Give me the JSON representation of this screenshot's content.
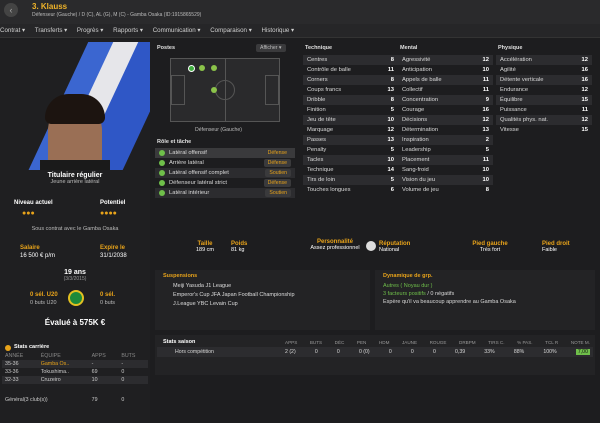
{
  "header": {
    "title": "3. Klauss",
    "subtitle": "Défenseur (Gauche) / D (C), AL (G), M (C) - Gamba Osaka (ID:1915865529)"
  },
  "menu": [
    "Contrat ▾",
    "Transferts ▾",
    "Progrès ▾",
    "Rapports ▾",
    "Communication ▾",
    "Comparaison ▾",
    "Historique ▾"
  ],
  "profile": {
    "role": "Titulaire régulier",
    "role_sub": "Jeune arrière latéral",
    "level_label": "Niveau actuel",
    "potential_label": "Potentiel",
    "contract": "Sous contrat avec le Gamba Osaka",
    "salary_label": "Salaire",
    "salary": "16 500 € p/m",
    "expiry_label": "Expire le",
    "expiry": "31/1/2038",
    "age": "19 ans",
    "dob": "(3/3/2015)",
    "u20_1": "0 sél. U20",
    "u20_1b": "0 buts U20",
    "u20_2": "0 sél.",
    "u20_2b": "0 buts",
    "value": "Évalué à 575K €"
  },
  "career": {
    "title": "Stats carrière",
    "headers": [
      "ANNÉE",
      "ÉQUIPE",
      "APPS",
      "BUTS"
    ],
    "rows": [
      [
        "35-36",
        "Gamba Os..",
        "-",
        "-"
      ],
      [
        "33-36",
        "Tokushima..",
        "69",
        "0"
      ],
      [
        "32-33",
        "Cruzeiro",
        "10",
        "0"
      ]
    ],
    "total": [
      "Général(3 club(s))",
      "79",
      "0"
    ]
  },
  "positions": {
    "title": "Postes",
    "btn": "Afficher ▾",
    "caption": "Défenseur (Gauche)"
  },
  "roles": {
    "title": "Rôle et tâche",
    "items": [
      [
        "Latéral offensif",
        "Défense"
      ],
      [
        "Arrière latéral",
        "Défense"
      ],
      [
        "Latéral offensif complet",
        "Soutien"
      ],
      [
        "Défenseur latéral strict",
        "Défense"
      ],
      [
        "Latéral intérieur",
        "Soutien"
      ]
    ]
  },
  "technique": {
    "title": "Technique",
    "rows": [
      [
        "Centres",
        "8"
      ],
      [
        "Contrôle de balle",
        "11"
      ],
      [
        "Corners",
        "8"
      ],
      [
        "Coups francs",
        "13"
      ],
      [
        "Dribble",
        "8"
      ],
      [
        "Finition",
        "5"
      ],
      [
        "Jeu de tête",
        "10"
      ],
      [
        "Marquage",
        "12"
      ],
      [
        "Passes",
        "13"
      ],
      [
        "Penalty",
        "5"
      ],
      [
        "Tacles",
        "10"
      ],
      [
        "Technique",
        "14"
      ],
      [
        "Tirs de loin",
        "5"
      ],
      [
        "Touches longues",
        "6"
      ]
    ]
  },
  "mental": {
    "title": "Mental",
    "rows": [
      [
        "Agressivité",
        "12"
      ],
      [
        "Anticipation",
        "10"
      ],
      [
        "Appels de balle",
        "11"
      ],
      [
        "Collectif",
        "11"
      ],
      [
        "Concentration",
        "9"
      ],
      [
        "Courage",
        "16"
      ],
      [
        "Décisions",
        "12"
      ],
      [
        "Détermination",
        "13"
      ],
      [
        "Inspiration",
        "2"
      ],
      [
        "Leadership",
        "5"
      ],
      [
        "Placement",
        "11"
      ],
      [
        "Sang-froid",
        "10"
      ],
      [
        "Vision du jeu",
        "10"
      ],
      [
        "Volume de jeu",
        "8"
      ]
    ]
  },
  "physique": {
    "title": "Physique",
    "rows": [
      [
        "Accélération",
        "12"
      ],
      [
        "Agilité",
        "16"
      ],
      [
        "Détente verticale",
        "16"
      ],
      [
        "Endurance",
        "12"
      ],
      [
        "Équilibre",
        "15"
      ],
      [
        "Puissance",
        "11"
      ],
      [
        "Qualités phys. nat.",
        "12"
      ],
      [
        "Vitesse",
        "15"
      ]
    ]
  },
  "info": [
    [
      "Taille",
      "189 cm"
    ],
    [
      "Poids",
      "81 kg"
    ],
    [
      "Personnalité",
      "Assez professionnel"
    ],
    [
      "Réputation",
      "National"
    ],
    [
      "Pied gauche",
      "Très fort"
    ],
    [
      "Pied droit",
      "Faible"
    ]
  ],
  "suspensions": {
    "title": "Suspensions",
    "items": [
      "Meiji Yasuda J1 League",
      "Emperor's Cup JFA Japan Football Championship",
      "J.League YBC Levain Cup"
    ]
  },
  "dynamics": {
    "title": "Dynamique de grp.",
    "sub": "Autres ( Noyau dur )",
    "factors": "3 facteurs positifs",
    "neg": "/ 0 négatifs",
    "text": "Espère qu'il va beaucoup apprendre au Gamba Osaka"
  },
  "season": {
    "title": "Stats saison",
    "headers": [
      "APPS",
      "BUTS",
      "DÉC",
      "PEN",
      "HDM",
      "JAUNE",
      "ROUGE",
      "DRBPM",
      "TIRS C.",
      "% PAS.",
      "TCL R",
      "NOTE M."
    ],
    "row_label": "Hors compétition",
    "row": [
      "2 (2)",
      "0",
      "0",
      "0 (0)",
      "0",
      "0",
      "0",
      "0,39",
      "33%",
      "88%",
      "100%",
      "7,00"
    ]
  }
}
